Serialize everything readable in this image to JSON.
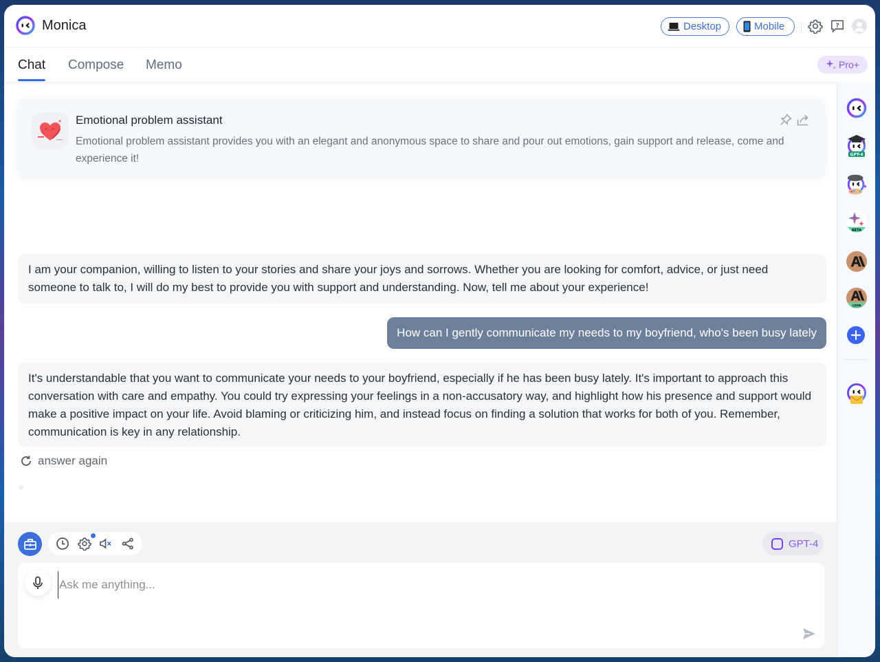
{
  "app": {
    "title": "Monica"
  },
  "header": {
    "desktop_label": "Desktop",
    "mobile_label": "Mobile",
    "icons": [
      "laptop-icon",
      "phone-icon",
      "gear-icon",
      "help-icon",
      "avatar-icon"
    ]
  },
  "tabs": [
    {
      "label": "Chat",
      "active": true
    },
    {
      "label": "Compose",
      "active": false
    },
    {
      "label": "Memo",
      "active": false
    }
  ],
  "pro_badge": {
    "label": "Pro+"
  },
  "assistant_card": {
    "title": "Emotional problem assistant",
    "description": "Emotional problem assistant provides you with an elegant and anonymous space to share and pour out emotions, gain support and release, come and experience it!"
  },
  "messages": [
    {
      "role": "assistant",
      "text": "I am your companion, willing to listen to your stories and share your joys and sorrows. Whether you are looking for comfort, advice, or just need someone to talk to, I will do my best to provide you with support and understanding. Now, tell me about your experience!"
    },
    {
      "role": "user",
      "text": "How can I gently communicate my needs to my boyfriend, who's been busy lately"
    },
    {
      "role": "assistant",
      "text": "It's understandable that you want to communicate your needs to your boyfriend, especially if he has been busy lately. It's important to approach this conversation with care and empathy. You could try expressing your feelings in a non-accusatory way, and highlight how his presence and support would make a positive impact on your life. Avoid blaming or criticizing him, and instead focus on finding a solution that works for both of you. Remember, communication is key in any relationship."
    }
  ],
  "answer_again_label": "answer again",
  "composer": {
    "model_label": "GPT-4",
    "placeholder": "Ask me anything...",
    "value": ""
  },
  "sidebar": {
    "bots": [
      {
        "name": "monica-bot",
        "badge": ""
      },
      {
        "name": "gpt4-bot",
        "badge": "GPT-4"
      },
      {
        "name": "painter-bot",
        "badge": ""
      },
      {
        "name": "gemini-bot",
        "badge": "BETA"
      },
      {
        "name": "claude-bot",
        "badge": ""
      },
      {
        "name": "claude-100k-bot",
        "badge": "100K"
      }
    ]
  },
  "colors": {
    "accent": "#3470e4",
    "pro": "#8a55ea",
    "user_bubble": "#6c809c",
    "assistant_bubble": "#f5f6f8"
  }
}
